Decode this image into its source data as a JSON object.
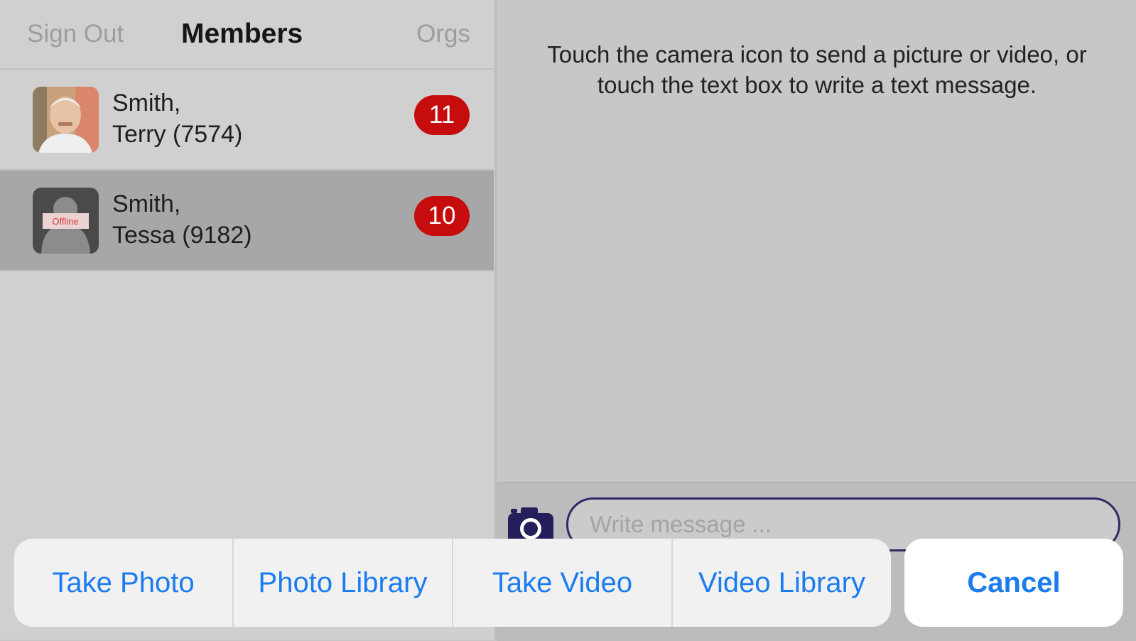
{
  "nav": {
    "sign_out": "Sign Out",
    "title": "Members",
    "orgs": "Orgs"
  },
  "members": [
    {
      "last": "Smith,",
      "first": "Terry (7574)",
      "unread": "11",
      "avatar": "photo-avatar-icon",
      "selected": false
    },
    {
      "last": "Smith,",
      "first": "Tessa (9182)",
      "unread": "10",
      "avatar": "offline-avatar-icon",
      "status_label": "Offline",
      "selected": true
    }
  ],
  "chat": {
    "instructions_line1": "Touch the camera icon to send a picture or video, or",
    "instructions_line2": "touch the text box to write a text message.",
    "input_placeholder": "Write message ...",
    "camera_icon": "camera-icon"
  },
  "action_sheet": {
    "buttons": [
      "Take Photo",
      "Photo Library",
      "Take Video",
      "Video Library"
    ],
    "cancel": "Cancel"
  },
  "colors": {
    "accent": "#1a7cf0",
    "badge": "#c60c0c",
    "input_border": "#2e2a66"
  }
}
